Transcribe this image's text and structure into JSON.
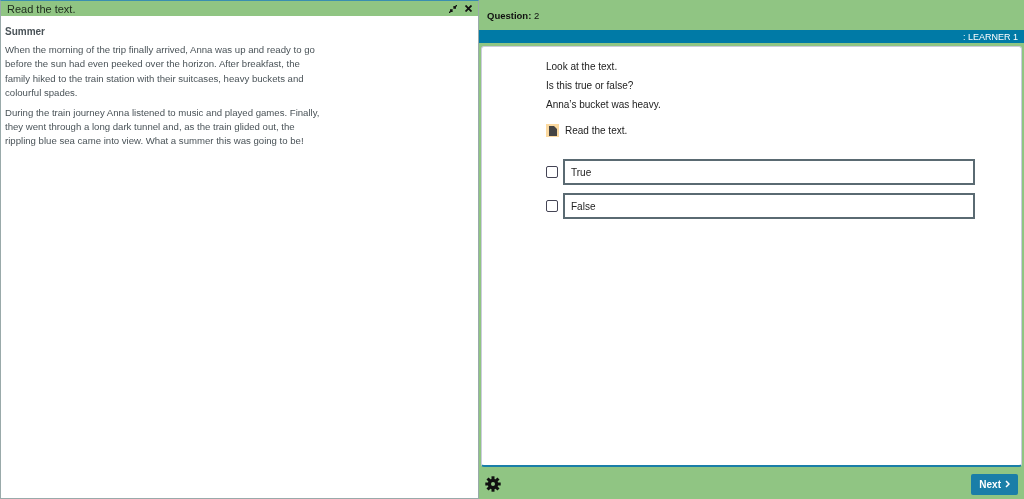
{
  "reading_panel": {
    "title": "Read the text.",
    "heading": "Summer",
    "paragraphs": [
      "When the morning of the trip finally arrived, Anna was up and ready to go before the sun had even peeked over the horizon. After breakfast, the family hiked to the train station with their suitcases, heavy buckets and colourful spades.",
      "During the train journey Anna listened to music and played games. Finally, they went through a long dark tunnel and, as the train glided out, the rippling blue sea came into view. What a summer this was going to be!"
    ]
  },
  "header": {
    "question": "**Question:** 2",
    "learner": ": LEARNER 1"
  },
  "question": {
    "lines": [
      "Look at the text.",
      "Is this true or false?",
      "Anna’s bucket was heavy."
    ],
    "resource_link": "Read the text.",
    "options": [
      {
        "label": "True",
        "checked": false
      },
      {
        "label": "False",
        "checked": false
      }
    ]
  },
  "footer": {
    "next": "Next"
  }
}
